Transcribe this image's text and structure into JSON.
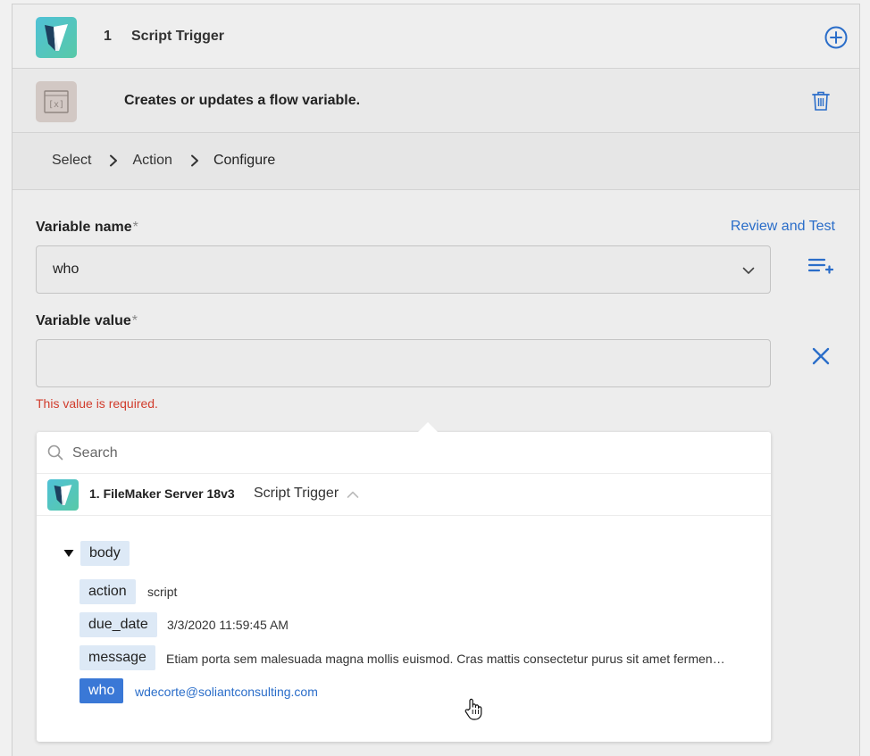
{
  "trigger": {
    "step_number": "1",
    "title": "Script Trigger",
    "app_icon": "filemaker-icon",
    "add_icon": "plus-circle-icon"
  },
  "action": {
    "description": "Creates or updates a flow variable.",
    "icon": "variable-icon",
    "delete_icon": "trash-icon"
  },
  "breadcrumb": {
    "items": [
      "Select",
      "Action",
      "Configure"
    ],
    "separator_icon": "chevron-right-icon"
  },
  "form": {
    "review_link": "Review and Test",
    "variable_name": {
      "label": "Variable name",
      "required_mark": "*",
      "value": "who"
    },
    "variable_value": {
      "label": "Variable value",
      "required_mark": "*",
      "value": "",
      "error": "This value is required."
    }
  },
  "picker": {
    "search_placeholder": "Search",
    "source": {
      "title": "1. FileMaker Server 18v3",
      "subtitle": "Script Trigger"
    },
    "tree": {
      "root": "body",
      "fields": [
        {
          "key": "action",
          "value": "script",
          "selected": false
        },
        {
          "key": "due_date",
          "value": "3/3/2020 11:59:45 AM",
          "selected": false
        },
        {
          "key": "message",
          "value": "Etiam porta sem malesuada magna mollis euismod. Cras mattis consectetur purus sit amet fermen…",
          "selected": false
        },
        {
          "key": "who",
          "value": "wdecorte@soliantconsulting.com",
          "selected": true
        }
      ]
    }
  },
  "colors": {
    "accent": "#2a6dc9",
    "error": "#d13c2c",
    "chip": "#dde9f6",
    "chip_selected": "#3a78d6"
  }
}
